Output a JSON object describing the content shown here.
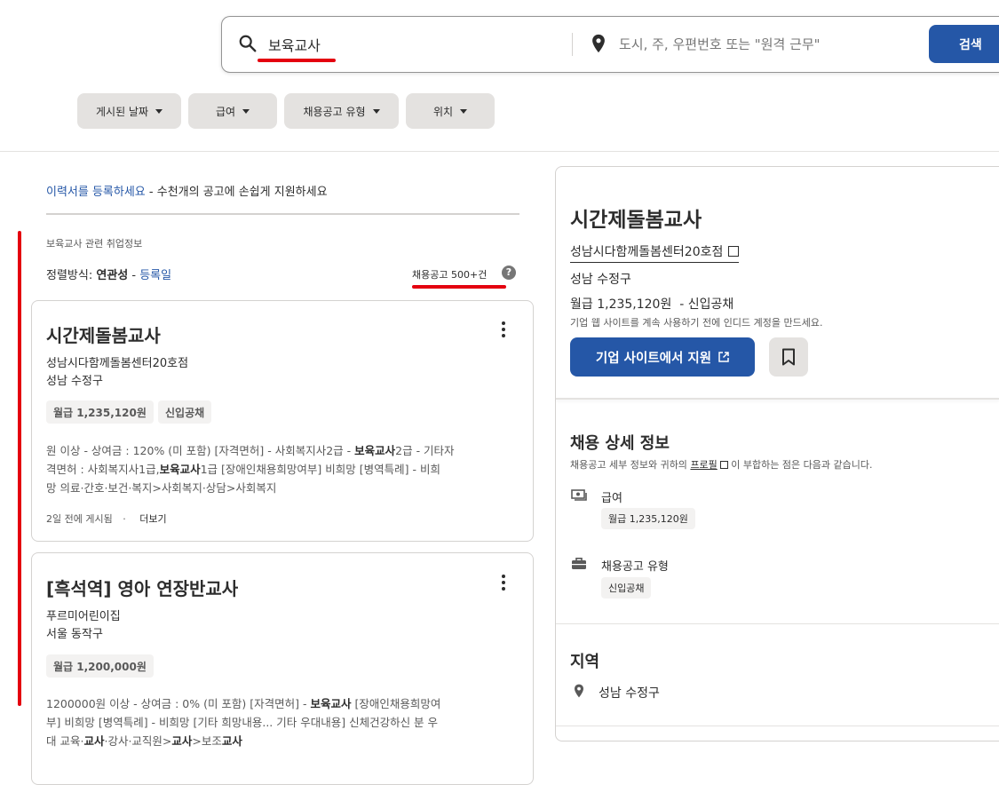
{
  "search": {
    "what_value": "보육교사",
    "where_placeholder": "도시, 주, 우편번호 또는 \"원격 근무\"",
    "button_label": "검색"
  },
  "filters": [
    {
      "label": "게시된 날짜"
    },
    {
      "label": "급여"
    },
    {
      "label": "채용공고 유형"
    },
    {
      "label": "위치"
    }
  ],
  "resume": {
    "link_text": "이력서를 등록하세요",
    "rest_text": " - 수천개의 공고에 손쉽게 지원하세요"
  },
  "results": {
    "related_label": "보육교사 관련 취업정보",
    "sort_prefix": "정렬방식: ",
    "sort_active": "연관성",
    "sort_sep": " - ",
    "sort_other": "등록일",
    "count_text": "채용공고 500+건",
    "help_glyph": "?"
  },
  "jobs": [
    {
      "title": "시간제돌봄교사",
      "company": "성남시다함께돌봄센터20호점",
      "location": "성남 수정구",
      "tags": [
        "월급 1,235,120원",
        "신입공채"
      ],
      "snippet_lines": [
        [
          "원 이상 - 상여금 : 120% (미 포함) [자격면허] - 사회복지사2급 - ",
          "보육교사",
          "2급 - 기타자"
        ],
        [
          "격면허 : 사회복지사1급,",
          "보육교사",
          "1급 [장애인채용희망여부] 비희망 [병역특례] - 비희"
        ],
        [
          "망 의료·간호·보건·복지>사회복지·상담>사회복지",
          "",
          ""
        ]
      ],
      "posted": "2일 전에 게시됨",
      "dot": "·",
      "more_label": "더보기"
    },
    {
      "title": "[흑석역] 영아 연장반교사",
      "company": "푸르미어린이집",
      "location": "서울 동작구",
      "tags": [
        "월급 1,200,000원"
      ],
      "snippet_lines": [
        [
          "1200000원 이상 - 상여금 : 0% (미 포함) [자격면허] - ",
          "보육교사",
          " [장애인채용희망여"
        ],
        [
          "부] 비희망 [병역특례] - 비희망 [기타 희망내용... 기타 우대내용] 신체건강하신 분 우",
          "",
          ""
        ],
        [
          "대 교육·",
          "교사",
          "·강사·교직원>"
        ],
        [
          "",
          "교사",
          ">보조"
        ],
        [
          "",
          "교사",
          ""
        ]
      ]
    }
  ],
  "detail": {
    "title": "시간제돌봄교사",
    "company": "성남시다함께돌봄센터20호점",
    "location": "성남 수정구",
    "salary": "월급 1,235,120원",
    "salary_sep": "  - ",
    "job_type": "신입공채",
    "note": "기업 웹 사이트를 계속 사용하기 전에 인디드 계정을 만드세요.",
    "apply_label": "기업 사이트에서 지원",
    "details_heading": "채용 상세 정보",
    "details_sub_before": "채용공고 세부 정보와 귀하의 ",
    "details_sub_link": "프로필",
    "details_sub_after": " 이 부합하는 점은 다음과 같습니다.",
    "pay_label": "급여",
    "pay_value": "월급 1,235,120원",
    "type_label": "채용공고 유형",
    "type_value": "신입공채",
    "region_heading": "지역",
    "region_value": "성남 수정구"
  },
  "colors": {
    "accent": "#2557a7",
    "highlight_red": "#e4000f",
    "chip_bg": "#e4e2e0"
  }
}
